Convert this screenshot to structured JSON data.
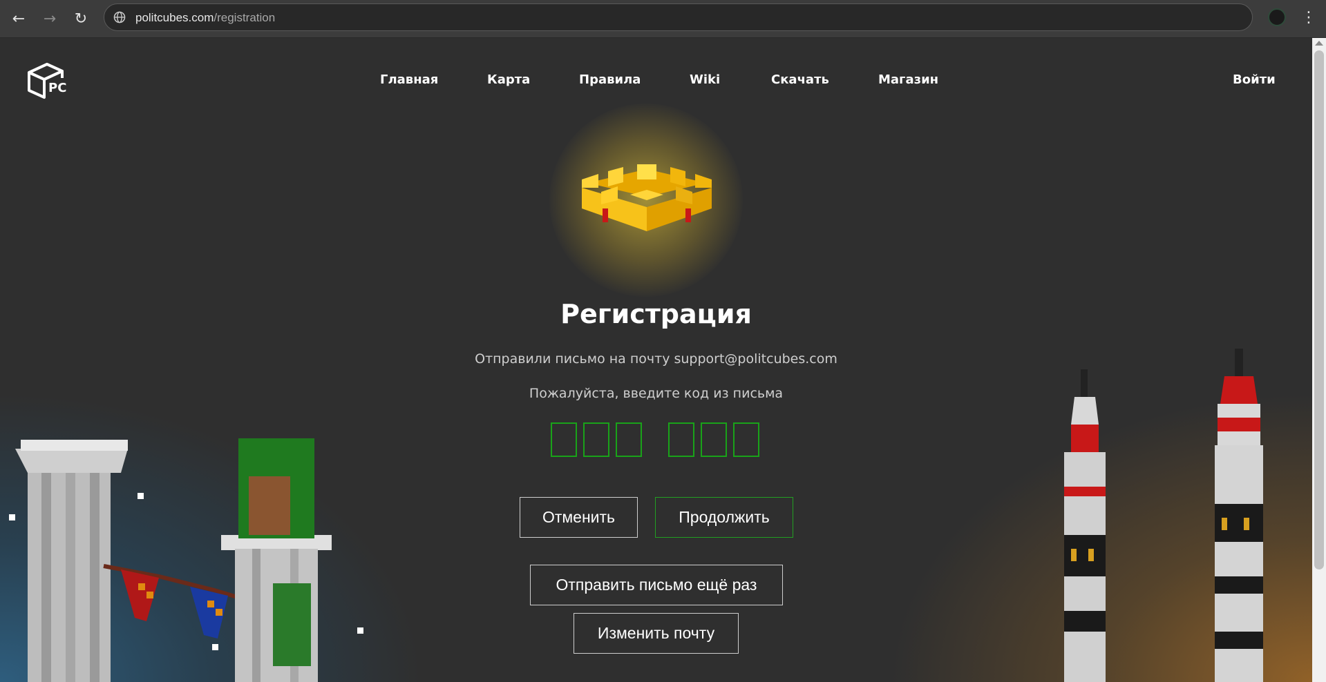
{
  "browser": {
    "url_host": "politcubes.com",
    "url_path": "/registration",
    "icons": [
      "back-arrow-icon",
      "forward-arrow-icon",
      "reload-icon",
      "site-info-icon",
      "profile-avatar",
      "menu-dots-icon"
    ]
  },
  "site": {
    "logo_text": "PC",
    "nav": [
      "Главная",
      "Карта",
      "Правила",
      "Wiki",
      "Скачать",
      "Магазин"
    ],
    "login": "Войти"
  },
  "registration": {
    "title": "Регистрация",
    "sent_message": "Отправили письмо на почту support@politcubes.com",
    "enter_code": "Пожалуйста, введите код из письма",
    "code_values": [
      "",
      "",
      "",
      "",
      "",
      ""
    ],
    "cancel": "Отменить",
    "continue": "Продолжить",
    "resend": "Отправить письмо ещё раз",
    "change_email": "Изменить почту"
  },
  "colors": {
    "accent_green": "#22a022",
    "crown_gold": "#f5c518",
    "background": "#2f2f2f"
  }
}
